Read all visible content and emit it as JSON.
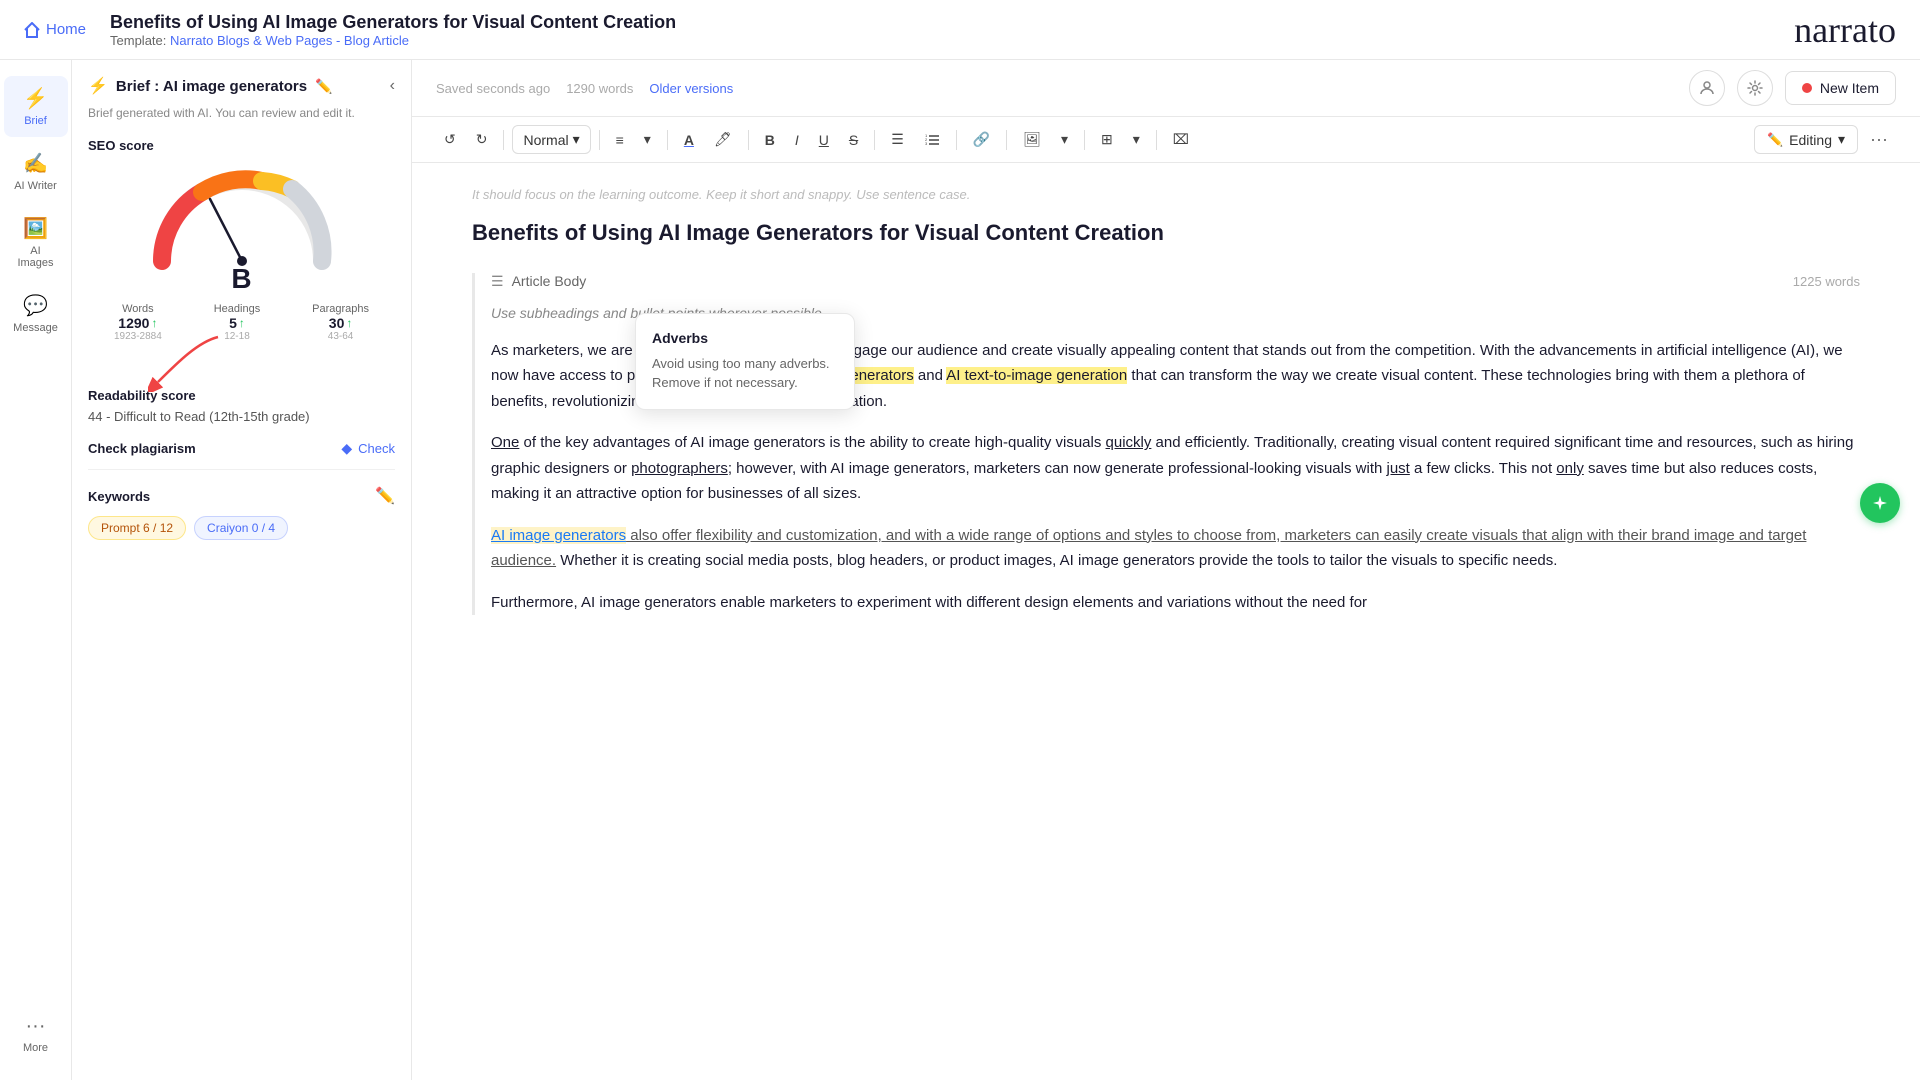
{
  "header": {
    "home_label": "Home",
    "title": "Benefits of Using AI Image Generators for Visual Content Creation",
    "template_label": "Template:",
    "template_name": "Narrato Blogs & Web Pages - Blog Article",
    "logo": "narrato"
  },
  "nav": {
    "items": [
      {
        "id": "brief",
        "label": "Brief",
        "icon": "⚡",
        "active": true
      },
      {
        "id": "ai-writer",
        "label": "AI Writer",
        "icon": "✍️",
        "active": false
      },
      {
        "id": "ai-images",
        "label": "AI Images",
        "icon": "🖼️",
        "active": false
      },
      {
        "id": "message",
        "label": "Message",
        "icon": "💬",
        "active": false
      },
      {
        "id": "more",
        "label": "More",
        "icon": "···",
        "active": false
      }
    ]
  },
  "brief_panel": {
    "title": "Brief : AI image generators",
    "subtitle": "Brief generated with AI. You can review and edit it.",
    "seo_score_label": "SEO score",
    "seo_grade": "B",
    "stats": {
      "words_label": "Words",
      "words_value": "1290",
      "words_arrow": "↑",
      "words_range": "1923-2884",
      "headings_label": "Headings",
      "headings_value": "5",
      "headings_arrow": "↑",
      "headings_range": "12-18",
      "paragraphs_label": "Paragraphs",
      "paragraphs_value": "30",
      "paragraphs_arrow": "↑",
      "paragraphs_range": "43-64"
    },
    "readability_label": "Readability score",
    "readability_score": "44 - Difficult to Read (12th-15th grade)",
    "plagiarism_label": "Check plagiarism",
    "check_label": "Check",
    "keywords_label": "Keywords",
    "keyword_tags": [
      {
        "text": "Prompt  6 / 12",
        "type": "yellow"
      },
      {
        "text": "Craiyon  0 / 4",
        "type": "blue"
      }
    ]
  },
  "editor_topbar": {
    "saved_text": "Saved seconds ago",
    "word_count": "1290 words",
    "older_versions": "Older versions",
    "new_item_label": "New Item"
  },
  "toolbar": {
    "undo": "↺",
    "redo": "↻",
    "format_label": "Normal",
    "align": "≡",
    "font_color": "A",
    "highlight": "🖊",
    "bold": "B",
    "italic": "I",
    "underline": "U",
    "strikethrough": "S",
    "bullet_list": "☰",
    "numbered_list": "1≡",
    "link": "🔗",
    "image": "🖼",
    "table": "⊞",
    "clear": "⌫",
    "editing_label": "Editing",
    "more": "···"
  },
  "editor": {
    "hint_text": "It should focus on the learning outcome. Keep it short and snappy. Use sentence case.",
    "title": "Benefits of Using AI Image Generators for Visual Content Creation",
    "article_section_title": "Article Body",
    "article_section_hint": "Use subheadings and bullet points wherever possible.",
    "article_word_count": "1225 words",
    "tooltip": {
      "title": "Adverbs",
      "description": "Avoid using too many adverbs. Remove if not necessary."
    },
    "paragraphs": [
      "As marketers, we are constantly looking for ways to engage our audience and create visually appealing content that stands out from the competition. With the advancements in artificial intelligence (AI), we now have access to powerful tools such as AI image generators and AI text-to-image generation that can transform the way we create visual content. These technologies bring with them a plethora of benefits, revolutionizing the world of visual content creation.",
      "One of the key advantages of AI image generators is the ability to create high-quality visuals quickly and efficiently. Traditionally, creating visual content required significant time and resources, such as hiring graphic designers or photographers; however, with AI image generators, marketers can now generate professional-looking visuals with just a few clicks. This not only saves time but also reduces costs, making it an attractive option for businesses of all sizes.",
      "AI image generators also offer flexibility and customization, and with a wide range of options and styles to choose from, marketers can easily create visuals that align with their brand image and target audience. Whether it is creating social media posts, blog headers, or product images, AI image generators provide the tools to tailor the visuals to specific needs.",
      "Furthermore, AI image generators enable marketers to experiment with different design elements and variations without the need for"
    ]
  }
}
